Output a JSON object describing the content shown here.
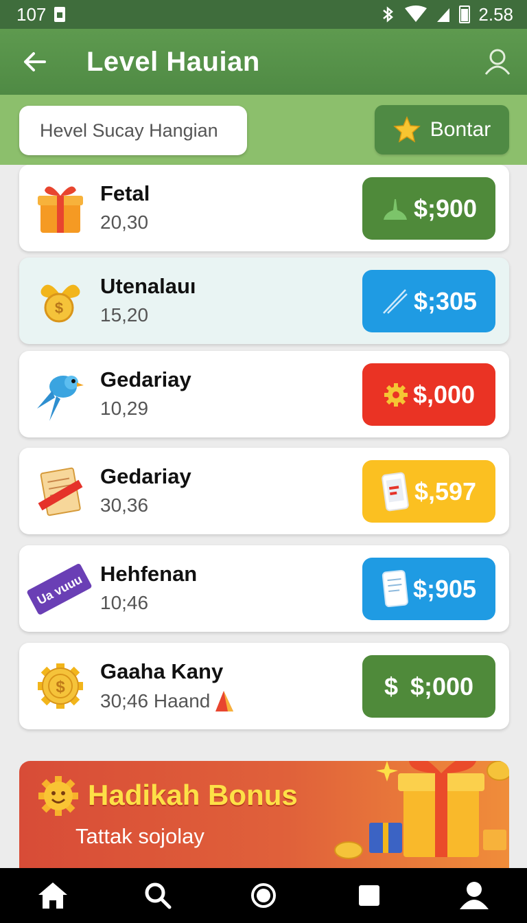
{
  "status_bar": {
    "left_number": "107",
    "time": "2.58"
  },
  "app_bar": {
    "title": "Level Hauian",
    "back_icon": "arrow-left-icon",
    "profile_icon": "user-icon"
  },
  "search": {
    "placeholder": "Hevel  Sucay Hangian",
    "button_label": "Bontar",
    "button_icon": "star-icon"
  },
  "items": [
    {
      "name": "Fetal",
      "sub": "20,30",
      "price": "$;900",
      "icon": "gift-icon",
      "price_icon": "bell-icon",
      "price_color": "#4f8a3a"
    },
    {
      "name": "Utenalauı",
      "sub": "15,20",
      "price": "$;305",
      "icon": "coin-bow-icon",
      "price_icon": "pen-icon",
      "price_color": "#1f9be3"
    },
    {
      "name": "Gedariay",
      "sub": "10,29",
      "price": "$,000",
      "icon": "bird-icon",
      "price_icon": "gear-icon",
      "price_color": "#ea3324"
    },
    {
      "name": "Gedariay",
      "sub": "30,36",
      "price": "$,597",
      "icon": "document-icon",
      "price_icon": "phone-icon",
      "price_color": "#fbc021"
    },
    {
      "name": "Hehfenan",
      "sub": "10;46",
      "price": "$;905",
      "icon": "ticket-icon",
      "price_icon": "tablet-icon",
      "price_color": "#1f9be3"
    },
    {
      "name": "Gaaha Kany",
      "sub": "30;46 Haand",
      "price": "$;000",
      "icon": "coin-gear-icon",
      "price_icon": "dollar-icon",
      "price_icon_text": "$",
      "price_color": "#4f8a3a"
    }
  ],
  "ticket_text": "Ua vuuu",
  "bonus": {
    "title": "Hadikah Bonus",
    "subtitle": "Tattak sojolay",
    "icon": "gift-box-icon"
  },
  "nav": [
    "home-icon",
    "search-icon",
    "circle-icon",
    "square-icon",
    "profile-icon"
  ]
}
